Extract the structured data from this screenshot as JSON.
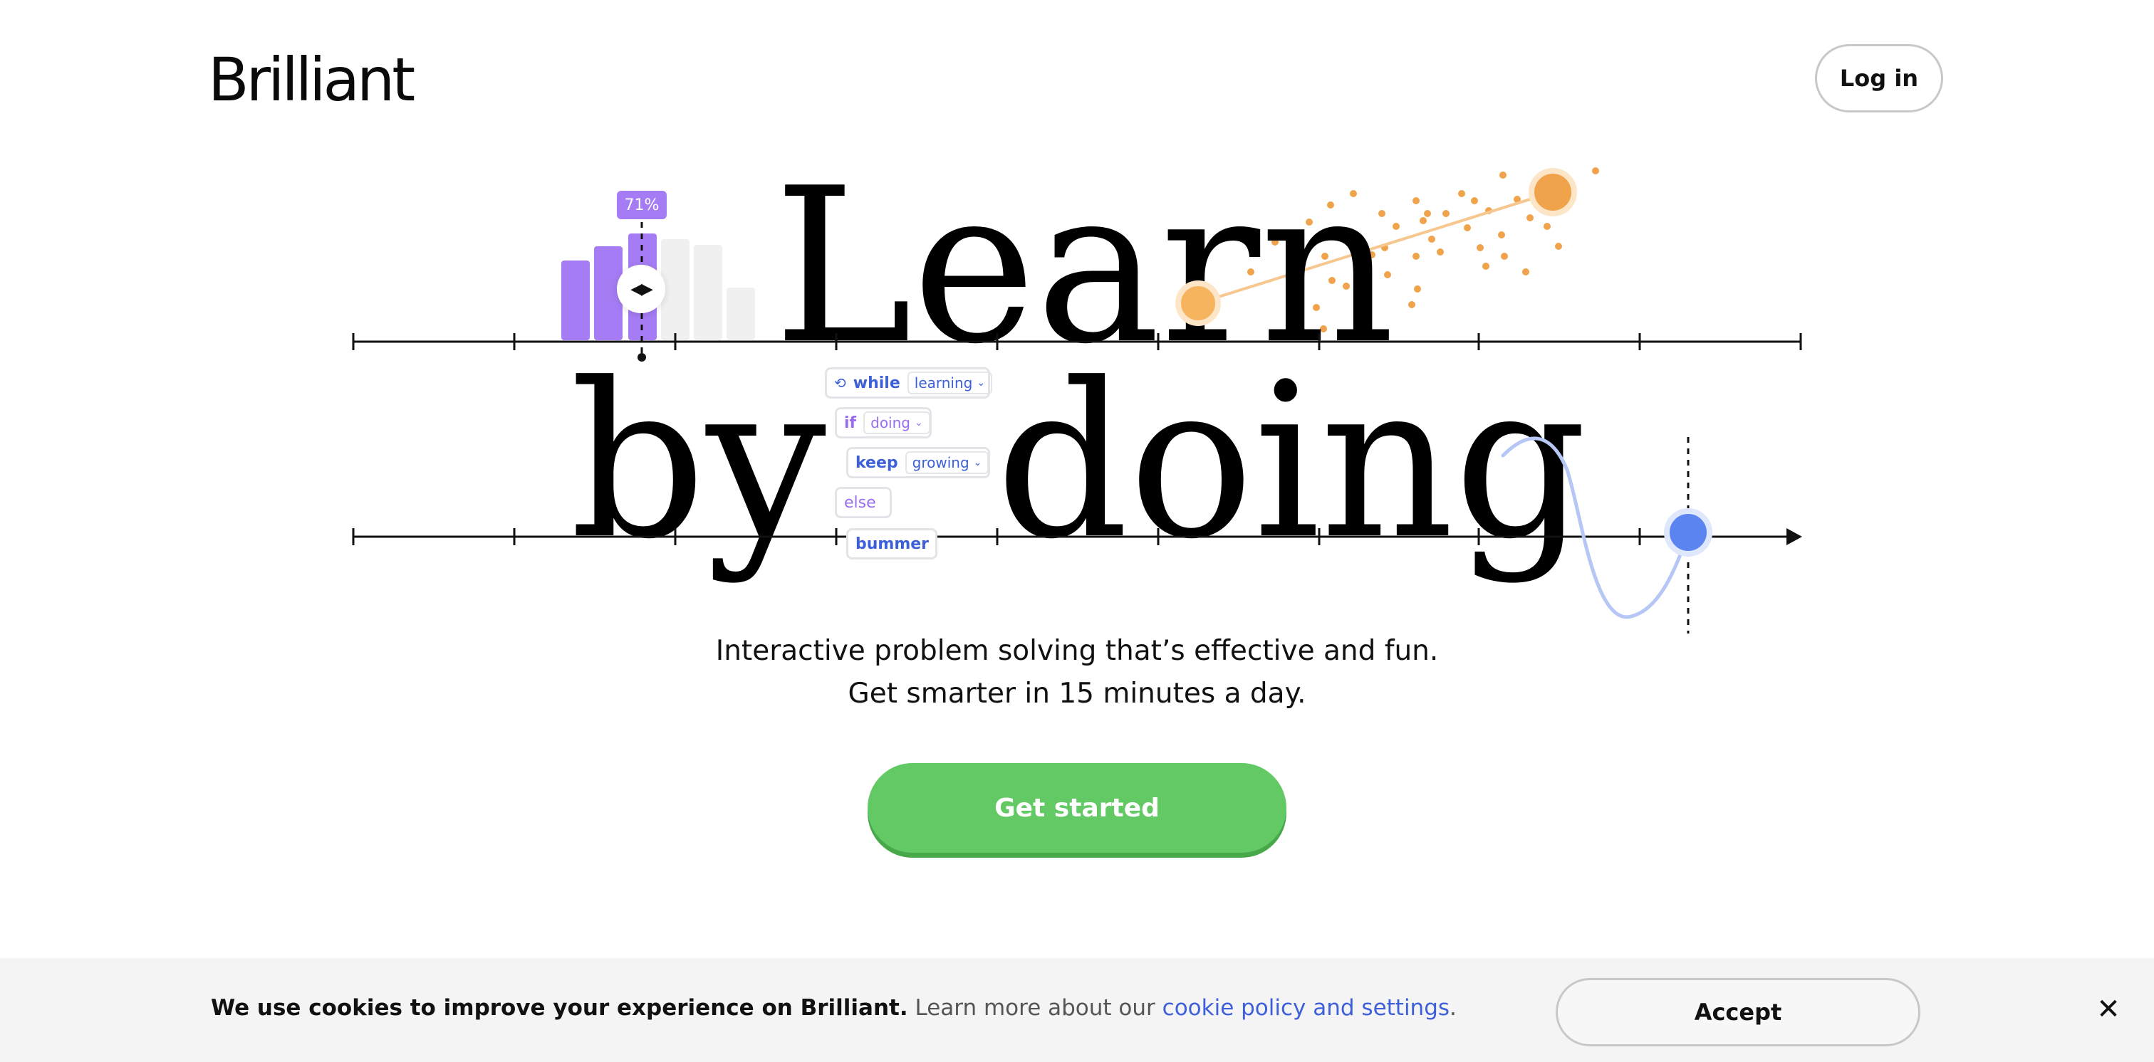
{
  "header": {
    "logo_text": "Brilliant",
    "login_label": "Log in"
  },
  "hero": {
    "headline_line1": "Learn",
    "headline_line2_word1": "by",
    "headline_line2_word2": "doing",
    "bar_widget": {
      "percent_label": "71%",
      "value": 0.71,
      "active_color": "#a57cf3",
      "inactive_color": "#f0f0f0"
    },
    "code_widget": {
      "rows": [
        {
          "keyword": "while",
          "chip": "learning"
        },
        {
          "keyword": "if",
          "chip": "doing"
        },
        {
          "keyword": "keep",
          "chip": "growing"
        },
        {
          "keyword": "else",
          "chip": ""
        },
        {
          "keyword": "bummer",
          "chip": ""
        }
      ]
    },
    "scatter_color": "#f0a34a",
    "wave_color": "#b6c6f5",
    "point_color": "#5b84f1"
  },
  "tagline": {
    "line1": "Interactive problem solving that’s effective and fun.",
    "line2": "Get smarter in 15 minutes a day."
  },
  "cta": {
    "label": "Get started",
    "color": "#62c964"
  },
  "cookie_banner": {
    "bold_text": "We use cookies to improve your experience on Brilliant.",
    "text": "Learn more about our",
    "link_text": "cookie policy and settings",
    "period": ".",
    "accept_label": "Accept",
    "close_icon": "close-icon"
  }
}
